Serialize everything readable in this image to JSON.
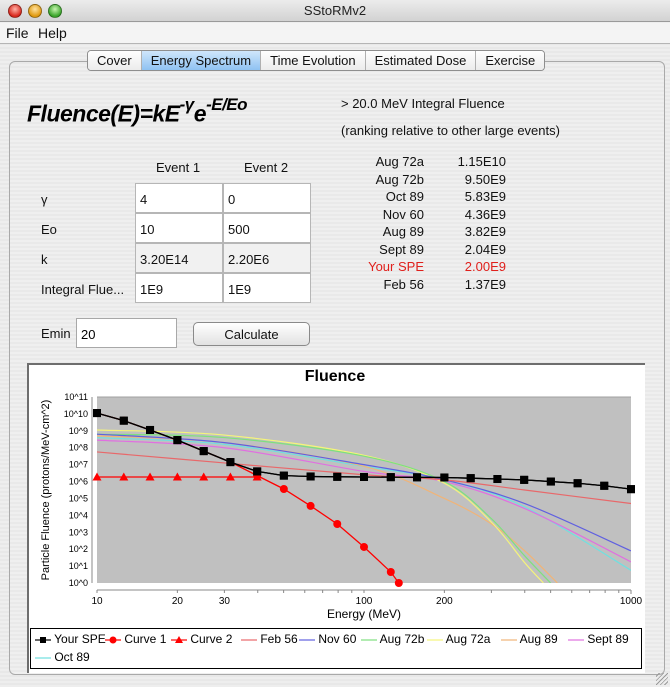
{
  "window": {
    "title": "SStoRMv2"
  },
  "menu": [
    "File",
    "Help"
  ],
  "tabs": [
    {
      "label": "Cover",
      "active": false
    },
    {
      "label": "Energy Spectrum",
      "active": true
    },
    {
      "label": "Time Evolution",
      "active": false
    },
    {
      "label": "Estimated Dose",
      "active": false
    },
    {
      "label": "Exercise",
      "active": false
    }
  ],
  "formula": {
    "base": "Fluence(E)=kE",
    "exp1": "-γ",
    "e": "e",
    "exp2": "-E/Eo"
  },
  "params": {
    "columns": [
      "Event 1",
      "Event 2"
    ],
    "rows": [
      {
        "label": "γ",
        "values": [
          "4",
          "0"
        ]
      },
      {
        "label": "Eo",
        "values": [
          "10",
          "500"
        ]
      },
      {
        "label": "k",
        "values": [
          "3.20E14",
          "2.20E6"
        ]
      },
      {
        "label": "Integral Flue...",
        "values": [
          "1E9",
          "1E9"
        ]
      }
    ],
    "emin_label": "Emin",
    "emin_value": "20",
    "calculate_label": "Calculate"
  },
  "ranking": {
    "heading": "> 20.0 MeV Integral Fluence",
    "subheading": "(ranking relative to other large events)",
    "rows": [
      {
        "name": "Aug 72a",
        "value": "1.15E10",
        "highlight": false
      },
      {
        "name": "Aug 72b",
        "value": "9.50E9",
        "highlight": false
      },
      {
        "name": "Oct 89",
        "value": "5.83E9",
        "highlight": false
      },
      {
        "name": "Nov 60",
        "value": "4.36E9",
        "highlight": false
      },
      {
        "name": "Aug 89",
        "value": "3.82E9",
        "highlight": false
      },
      {
        "name": "Sept 89",
        "value": "2.04E9",
        "highlight": false
      },
      {
        "name": "Your SPE",
        "value": "2.00E9",
        "highlight": true
      },
      {
        "name": "Feb 56",
        "value": "1.37E9",
        "highlight": false
      }
    ]
  },
  "chart_data": {
    "type": "line",
    "title": "Fluence",
    "xlabel": "Energy (MeV)",
    "ylabel": "Particle Fluence (protons/MeV-cm^2)",
    "xscale": "log",
    "yscale": "log",
    "xlim": [
      10,
      1000
    ],
    "ylim": [
      1,
      100000000000.0
    ],
    "xticks": [
      {
        "value": 10,
        "label": "10"
      },
      {
        "value": 20,
        "label": "20"
      },
      {
        "value": 30,
        "label": "30"
      },
      {
        "value": 100,
        "label": "100"
      },
      {
        "value": 200,
        "label": "200"
      },
      {
        "value": 1000,
        "label": "1000"
      }
    ],
    "yticks": [
      {
        "value": 0,
        "label": "10^0"
      },
      {
        "value": 1,
        "label": "10^1"
      },
      {
        "value": 2,
        "label": "10^2"
      },
      {
        "value": 3,
        "label": "10^3"
      },
      {
        "value": 4,
        "label": "10^4"
      },
      {
        "value": 5,
        "label": "10^5"
      },
      {
        "value": 6,
        "label": "10^6"
      },
      {
        "value": 7,
        "label": "10^7"
      },
      {
        "value": 8,
        "label": "10^8"
      },
      {
        "value": 9,
        "label": "10^9"
      },
      {
        "value": 10,
        "label": "10^10"
      },
      {
        "value": 11,
        "label": "10^11"
      }
    ],
    "legend_position": "bottom",
    "background": "#c0c0c0",
    "series": [
      {
        "name": "Your SPE",
        "color": "#000000",
        "marker": "square",
        "x": [
          10,
          12.6,
          15.8,
          20,
          25.1,
          31.6,
          39.8,
          50.1,
          63.1,
          79.4,
          100,
          126,
          158,
          200,
          251,
          316,
          398,
          501,
          631,
          794,
          1000
        ],
        "log10y": [
          10.05,
          9.6,
          9.05,
          8.45,
          7.8,
          7.15,
          6.6,
          6.35,
          6.3,
          6.28,
          6.27,
          6.26,
          6.25,
          6.24,
          6.2,
          6.15,
          6.1,
          6.0,
          5.9,
          5.75,
          5.55
        ]
      },
      {
        "name": "Curve 1",
        "color": "#ff0000",
        "marker": "circle",
        "x": [
          10,
          12.6,
          15.8,
          20,
          25.1,
          31.6,
          39.8,
          50.1,
          63.1,
          79.4,
          100,
          126,
          135
        ],
        "log10y": [
          10.05,
          9.6,
          9.05,
          8.45,
          7.8,
          7.15,
          6.35,
          5.56,
          4.56,
          3.49,
          2.13,
          0.65,
          0
        ]
      },
      {
        "name": "Curve 2",
        "color": "#ff0000",
        "marker": "triangle",
        "x": [
          10,
          12.6,
          15.8,
          20,
          25.1,
          31.6,
          39.8
        ],
        "log10y": [
          6.27,
          6.27,
          6.27,
          6.27,
          6.27,
          6.27,
          6.27
        ]
      },
      {
        "name": "Feb 56",
        "color": "#e8686a",
        "marker": "none",
        "x": [
          10,
          30,
          100,
          200,
          400,
          1000
        ],
        "log10y": [
          7.75,
          7.1,
          6.4,
          6.1,
          5.5,
          4.7
        ]
      },
      {
        "name": "Nov 60",
        "color": "#6060e0",
        "marker": "none",
        "x": [
          10,
          30,
          100,
          200,
          400,
          1000
        ],
        "log10y": [
          8.8,
          8.3,
          7.0,
          6.1,
          4.7,
          1.9
        ]
      },
      {
        "name": "Aug 72b",
        "color": "#7ee07e",
        "marker": "none",
        "x": [
          10,
          30,
          100,
          200,
          300,
          400,
          500
        ],
        "log10y": [
          8.8,
          8.6,
          7.5,
          6.0,
          3.8,
          1.6,
          0
        ]
      },
      {
        "name": "Aug 72a",
        "color": "#f5f57a",
        "marker": "none",
        "x": [
          10,
          30,
          100,
          200,
          300,
          400,
          470
        ],
        "log10y": [
          9.05,
          8.75,
          7.55,
          5.9,
          3.6,
          1.2,
          0
        ]
      },
      {
        "name": "Aug 89",
        "color": "#f0b478",
        "marker": "none",
        "x": [
          10,
          30,
          100,
          200,
          300,
          400,
          530
        ],
        "log10y": [
          8.7,
          8.3,
          6.9,
          5.0,
          3.5,
          1.9,
          0
        ]
      },
      {
        "name": "Sept 89",
        "color": "#e070e0",
        "marker": "none",
        "x": [
          10,
          30,
          100,
          200,
          400,
          1000
        ],
        "log10y": [
          8.45,
          8.0,
          6.6,
          6.0,
          4.4,
          1.25
        ]
      },
      {
        "name": "Oct 89",
        "color": "#70e0e0",
        "marker": "none",
        "x": [
          10,
          30,
          100,
          200,
          400,
          1000
        ],
        "log10y": [
          8.6,
          8.2,
          6.9,
          6.1,
          4.5,
          0.75
        ]
      }
    ]
  }
}
